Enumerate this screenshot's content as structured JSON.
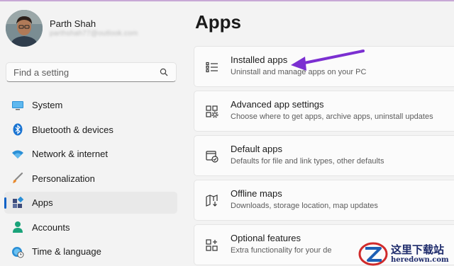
{
  "user": {
    "name": "Parth Shah",
    "email": "parthshah77@outlook.com"
  },
  "search": {
    "placeholder": "Find a setting"
  },
  "sidebar": {
    "items": [
      {
        "label": "System",
        "icon": "monitor-icon",
        "selected": false
      },
      {
        "label": "Bluetooth & devices",
        "icon": "bluetooth-icon",
        "selected": false
      },
      {
        "label": "Network & internet",
        "icon": "wifi-icon",
        "selected": false
      },
      {
        "label": "Personalization",
        "icon": "brush-icon",
        "selected": false
      },
      {
        "label": "Apps",
        "icon": "apps-icon",
        "selected": true
      },
      {
        "label": "Accounts",
        "icon": "person-icon",
        "selected": false
      },
      {
        "label": "Time & language",
        "icon": "globe-clock-icon",
        "selected": false
      }
    ]
  },
  "main": {
    "title": "Apps",
    "cards": [
      {
        "title": "Installed apps",
        "description": "Uninstall and manage apps on your PC",
        "icon": "list-icon"
      },
      {
        "title": "Advanced app settings",
        "description": "Choose where to get apps, archive apps, uninstall updates",
        "icon": "app-settings-icon"
      },
      {
        "title": "Default apps",
        "description": "Defaults for file and link types, other defaults",
        "icon": "default-apps-icon"
      },
      {
        "title": "Offline maps",
        "description": "Downloads, storage location, map updates",
        "icon": "map-download-icon"
      },
      {
        "title": "Optional features",
        "description": "Extra functionality for your de",
        "icon": "add-feature-icon"
      }
    ]
  },
  "annotation": {
    "arrow_color": "#7b2fd1"
  },
  "watermark": {
    "chinese": "这里下载站",
    "domain": "heredown.com"
  },
  "colors": {
    "accent": "#0f62c6",
    "background": "#f3f3f3",
    "card": "#fbfbfb"
  }
}
